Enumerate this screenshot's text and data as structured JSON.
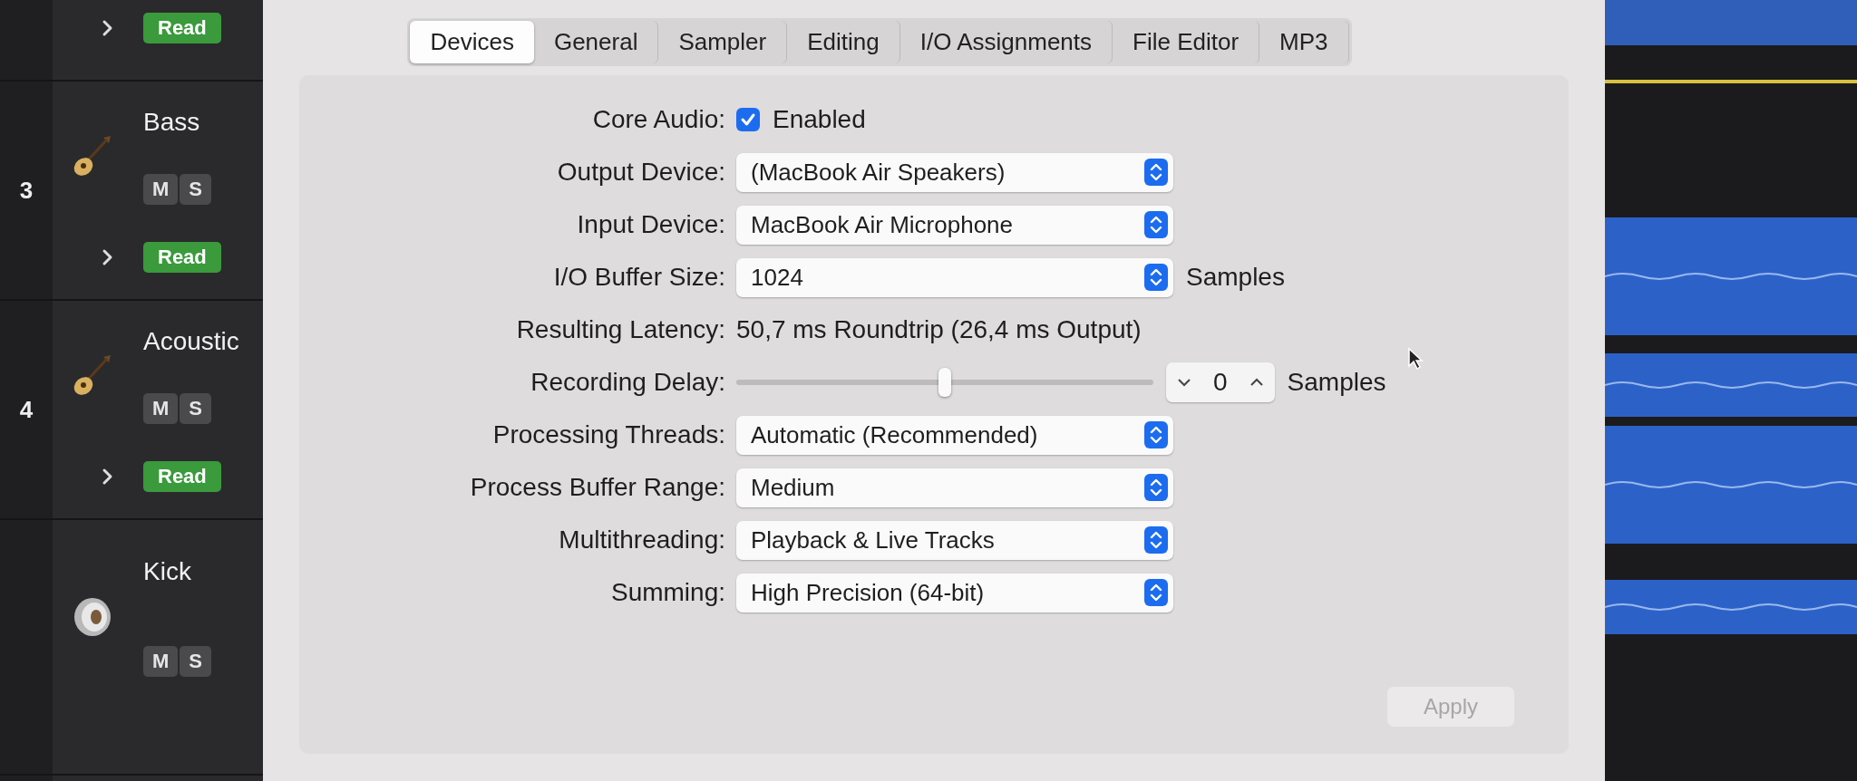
{
  "tracks": [
    {
      "kind": "partial",
      "automation": "Read"
    },
    {
      "kind": "guitar",
      "number": "3",
      "name": "Bass",
      "mute": "M",
      "solo": "S",
      "automation": "Read"
    },
    {
      "kind": "guitar",
      "number": "4",
      "name": "Acoustic",
      "mute": "M",
      "solo": "S",
      "automation": "Read"
    },
    {
      "kind": "drum",
      "name": "Kick",
      "mute": "M",
      "solo": "S"
    }
  ],
  "dialog": {
    "tabs": [
      {
        "label": "Devices",
        "selected": true
      },
      {
        "label": "General",
        "selected": false
      },
      {
        "label": "Sampler",
        "selected": false
      },
      {
        "label": "Editing",
        "selected": false
      },
      {
        "label": "I/O Assignments",
        "selected": false
      },
      {
        "label": "File Editor",
        "selected": false
      },
      {
        "label": "MP3",
        "selected": false
      }
    ],
    "rows": [
      {
        "kind": "checkbox",
        "label": "Core Audio:",
        "checked": true,
        "text": "Enabled"
      },
      {
        "kind": "popup",
        "label": "Output Device:",
        "value": "(MacBook Air Speakers)"
      },
      {
        "kind": "popup",
        "label": "Input Device:",
        "value": "MacBook Air Microphone"
      },
      {
        "kind": "popup",
        "label": "I/O Buffer Size:",
        "value": "1024",
        "unit": "Samples"
      },
      {
        "kind": "text",
        "label": "Resulting Latency:",
        "value": "50,7 ms Roundtrip (26,4 ms Output)"
      },
      {
        "kind": "slider",
        "label": "Recording Delay:",
        "level": 0.5,
        "stepper": "0",
        "unit": "Samples"
      },
      {
        "kind": "popup",
        "label": "Processing Threads:",
        "value": "Automatic (Recommended)"
      },
      {
        "kind": "popup",
        "label": "Process Buffer Range:",
        "value": "Medium"
      },
      {
        "kind": "popup",
        "label": "Multithreading:",
        "value": "Playback & Live Tracks"
      },
      {
        "kind": "popup",
        "label": "Summing:",
        "value": "High Precision (64-bit)"
      }
    ],
    "apply": {
      "label": "Apply",
      "disabled": true
    }
  }
}
